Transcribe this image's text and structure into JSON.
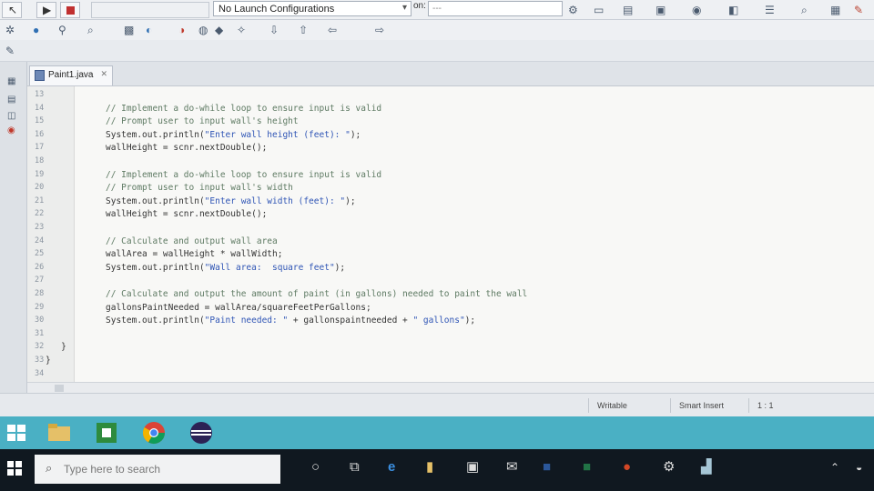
{
  "toolbar": {
    "launch_config": "No Launch Configurations",
    "on_label": "on:",
    "on_value": "---"
  },
  "editor": {
    "tab_title": "Paint1.java",
    "tab_close": "✕",
    "lines": [
      {
        "n": "13",
        "segments": []
      },
      {
        "n": "14",
        "segments": [
          {
            "t": "// Implement a do-while loop to ensure input is valid",
            "c": "comment"
          }
        ]
      },
      {
        "n": "15",
        "segments": [
          {
            "t": "// Prompt user to input wall's height",
            "c": "comment"
          }
        ]
      },
      {
        "n": "16",
        "segments": [
          {
            "t": "System.out.println(",
            "c": "code"
          },
          {
            "t": "\"Enter wall height (feet): \"",
            "c": "string"
          },
          {
            "t": ");",
            "c": "code"
          }
        ]
      },
      {
        "n": "17",
        "segments": [
          {
            "t": "wallHeight = scnr.nextDouble();",
            "c": "code"
          }
        ]
      },
      {
        "n": "18",
        "segments": []
      },
      {
        "n": "19",
        "segments": [
          {
            "t": "// Implement a do-while loop to ensure input is valid",
            "c": "comment"
          }
        ]
      },
      {
        "n": "20",
        "segments": [
          {
            "t": "// Prompt user to input wall's width",
            "c": "comment"
          }
        ]
      },
      {
        "n": "21",
        "segments": [
          {
            "t": "System.out.println(",
            "c": "code"
          },
          {
            "t": "\"Enter wall width (feet): \"",
            "c": "string"
          },
          {
            "t": ");",
            "c": "code"
          }
        ]
      },
      {
        "n": "22",
        "segments": [
          {
            "t": "wallHeight = scnr.nextDouble();",
            "c": "code"
          }
        ]
      },
      {
        "n": "23",
        "segments": []
      },
      {
        "n": "24",
        "segments": [
          {
            "t": "// Calculate and output wall area",
            "c": "comment"
          }
        ]
      },
      {
        "n": "25",
        "segments": [
          {
            "t": "wallArea = wallHeight * wallWidth;",
            "c": "code"
          }
        ]
      },
      {
        "n": "26",
        "segments": [
          {
            "t": "System.out.println(",
            "c": "code"
          },
          {
            "t": "\"Wall area:  square feet\"",
            "c": "string"
          },
          {
            "t": ");",
            "c": "code"
          }
        ]
      },
      {
        "n": "27",
        "segments": []
      },
      {
        "n": "28",
        "segments": [
          {
            "t": "// Calculate and output the amount of paint (in gallons) needed to paint the wall",
            "c": "comment"
          }
        ]
      },
      {
        "n": "29",
        "segments": [
          {
            "t": "gallonsPaintNeeded = wallArea/squareFeetPerGallons;",
            "c": "code"
          }
        ]
      },
      {
        "n": "30",
        "segments": [
          {
            "t": "System.out.println(",
            "c": "code"
          },
          {
            "t": "\"Paint needed: \"",
            "c": "string"
          },
          {
            "t": " + gallonspaintneeded + ",
            "c": "code"
          },
          {
            "t": "\" gallons\"",
            "c": "string"
          },
          {
            "t": ");",
            "c": "code"
          }
        ]
      },
      {
        "n": "31",
        "segments": []
      },
      {
        "n": "32",
        "segments": [
          {
            "t": "   }",
            "c": "code",
            "indent": "outer"
          }
        ]
      },
      {
        "n": "33",
        "segments": [
          {
            "t": "}",
            "c": "code",
            "indent": "outer"
          }
        ]
      },
      {
        "n": "34",
        "segments": []
      }
    ]
  },
  "status": {
    "mode": "Writable",
    "insert": "Smart Insert",
    "position": "1 : 1"
  },
  "taskbar": {
    "search_placeholder": "Type here to search"
  }
}
